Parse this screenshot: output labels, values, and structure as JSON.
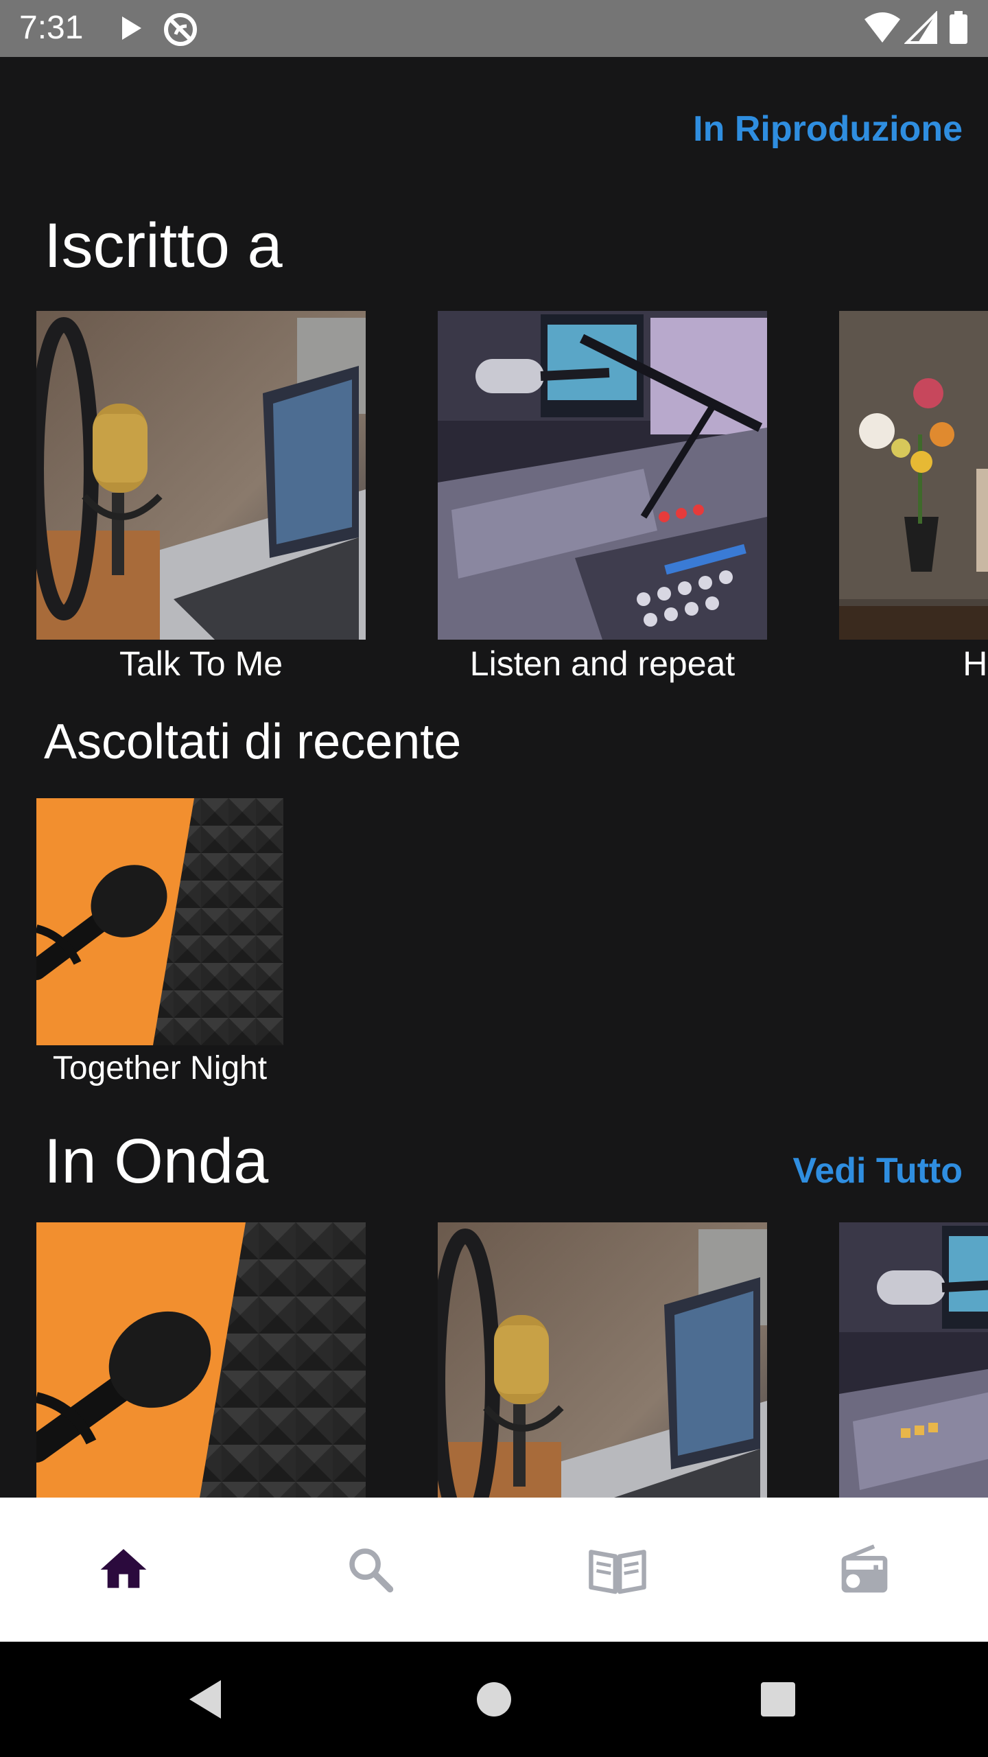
{
  "status_bar": {
    "time": "7:31",
    "icons": [
      "play-icon",
      "sync-circle-icon",
      "wifi-icon",
      "signal-icon",
      "battery-icon"
    ]
  },
  "header": {
    "now_playing_link": "In Riproduzione"
  },
  "subscribed": {
    "title": "Iscritto a",
    "items": [
      {
        "label": "Talk To Me",
        "image": "gold-microphone-laptop"
      },
      {
        "label": "Listen and repeat",
        "image": "mixing-console"
      },
      {
        "label": "Head",
        "image": "flower-vase"
      }
    ]
  },
  "recent": {
    "title": "Ascoltati di recente",
    "items": [
      {
        "label": "Together Night",
        "image": "black-mic-orange"
      }
    ]
  },
  "on_air": {
    "title": "In Onda",
    "see_all": "Vedi Tutto",
    "items": [
      {
        "image": "black-mic-orange"
      },
      {
        "image": "gold-microphone-laptop"
      },
      {
        "image": "mixing-console"
      }
    ]
  },
  "bottom_nav": {
    "items": [
      {
        "icon": "home-icon",
        "active": true
      },
      {
        "icon": "search-icon",
        "active": false
      },
      {
        "icon": "book-icon",
        "active": false
      },
      {
        "icon": "radio-icon",
        "active": false
      }
    ],
    "active_color": "#2b0a3d",
    "inactive_color": "#a7aab2"
  },
  "colors": {
    "background": "#161617",
    "accent": "#2f8ee0",
    "status_bar": "#757575"
  }
}
